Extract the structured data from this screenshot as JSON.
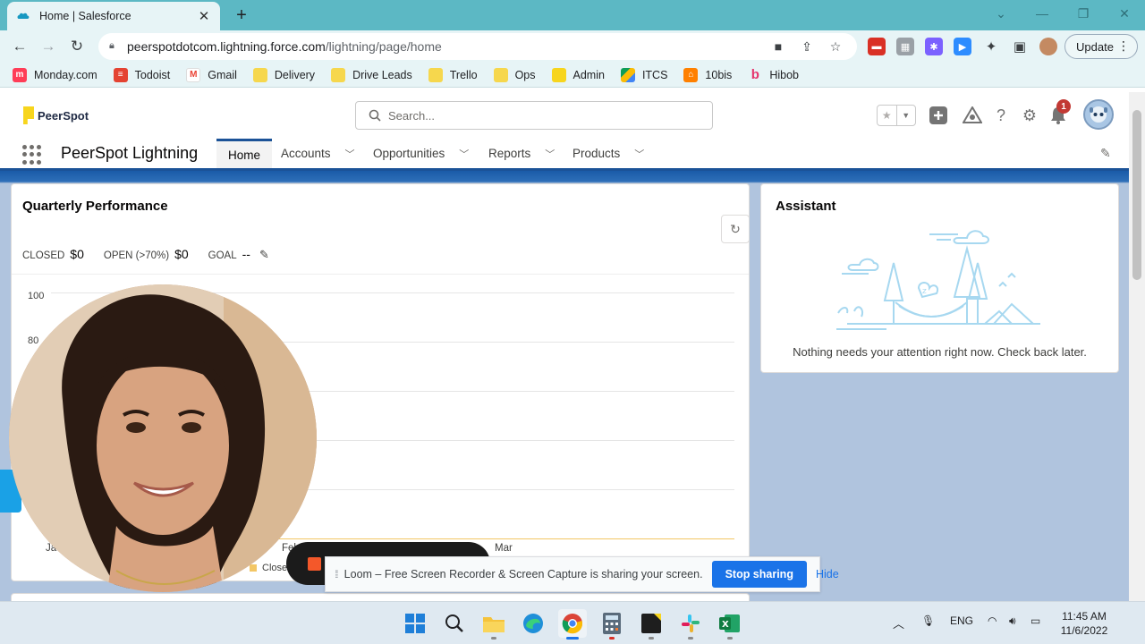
{
  "browser": {
    "tab_title": "Home | Salesforce",
    "url_host": "peerspotdotcom.lightning.force.com",
    "url_path": "/lightning/page/home",
    "update_label": "Update",
    "bookmarks": [
      {
        "label": "Monday.com",
        "icon": "monday-icon"
      },
      {
        "label": "Todoist",
        "icon": "todoist-icon"
      },
      {
        "label": "Gmail",
        "icon": "gmail-icon"
      },
      {
        "label": "Delivery",
        "icon": "folder-icon"
      },
      {
        "label": "Drive Leads",
        "icon": "folder-icon"
      },
      {
        "label": "Trello",
        "icon": "folder-icon"
      },
      {
        "label": "Ops",
        "icon": "folder-icon"
      },
      {
        "label": "Admin",
        "icon": "folder-icon"
      },
      {
        "label": "ITCS",
        "icon": "google-drive-icon"
      },
      {
        "label": "10bis",
        "icon": "10bis-icon"
      },
      {
        "label": "Hibob",
        "icon": "hibob-icon"
      }
    ]
  },
  "header": {
    "logo_text": "PeerSpot",
    "search_placeholder": "Search...",
    "notification_count": "1"
  },
  "nav": {
    "app_name": "PeerSpot Lightning",
    "items": [
      {
        "label": "Home"
      },
      {
        "label": "Accounts"
      },
      {
        "label": "Opportunities"
      },
      {
        "label": "Reports"
      },
      {
        "label": "Products"
      }
    ]
  },
  "performance": {
    "title": "Quarterly Performance",
    "closed_label": "CLOSED",
    "closed_value": "$0",
    "open_label": "OPEN (>70%)",
    "open_value": "$0",
    "goal_label": "GOAL",
    "goal_value": "--",
    "y_ticks": [
      "100",
      "80"
    ],
    "x_ticks": [
      "Ja",
      "Feb",
      "Mar"
    ],
    "legend_closed": "Close"
  },
  "assistant": {
    "title": "Assistant",
    "message": "Nothing needs your attention right now. Check back later."
  },
  "loom": {
    "message": "Loom – Free Screen Recorder & Screen Capture is sharing your screen.",
    "stop_label": "Stop sharing",
    "hide_label": "Hide"
  },
  "taskbar": {
    "lang": "ENG",
    "time": "11:45 AM",
    "date": "11/6/2022"
  },
  "colors": {
    "chrome_frame": "#5cb8c4",
    "sf_brand": "#1b5297",
    "notification_badge": "#c23934",
    "share_button": "#1a73e8"
  }
}
